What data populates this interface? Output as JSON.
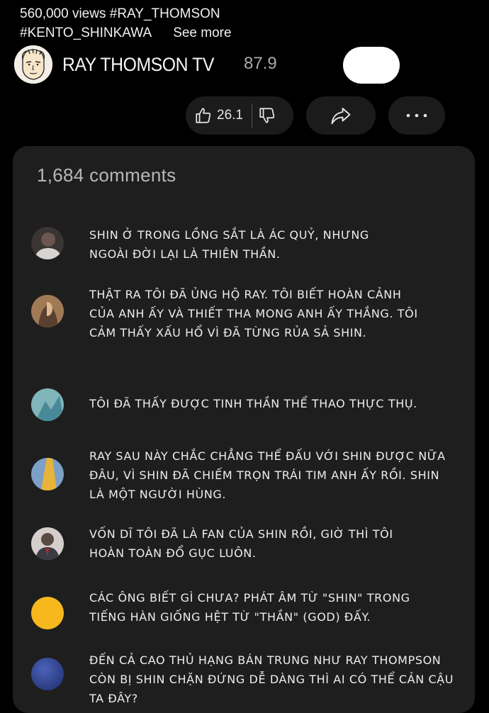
{
  "video": {
    "views_tags": "560,000 views #RAY_THOMSON",
    "tag2": "#KENTO_SHINKAWA",
    "see_more": "See more"
  },
  "channel": {
    "name": "RAY THOMSON TV",
    "subscribers": "87.9"
  },
  "actions": {
    "likes": "26.1"
  },
  "comments": {
    "count_label": "1,684 comments",
    "items": [
      {
        "text": "SHIN Ở TRONG LỒNG SẮT LÀ ÁC QUỶ, NHƯNG\nNGOÀI ĐỜI LẠI LÀ THIÊN THẦN.",
        "avatar_color": "#5a4a48"
      },
      {
        "text": "THẬT RA TÔI ĐÃ ỦNG HỘ RAY. TÔI BIẾT HOÀN CẢNH\nCỦA ANH ẤY VÀ THIẾT THA MONG ANH ẤY THẮNG. TÔI\nCẢM THẤY XẤU HỔ VÌ ĐÃ TỪNG RỦA SẢ SHIN.",
        "avatar_color": "#8a6a4e"
      },
      {
        "text": "TÔI ĐÃ THẤY ĐƯỢC TINH THẦN THỂ THAO THỰC THỤ.",
        "avatar_color": "#6aa3a8"
      },
      {
        "text": "RAY SAU NÀY CHẮC CHẲNG THỂ ĐẤU VỚI SHIN ĐƯỢC NỮA\nĐÂU, VÌ SHIN ĐÃ CHIẾM TRỌN TRÁI TIM ANH ẤY RỒI. SHIN\nLÀ MỘT NGƯỜI HÙNG.",
        "avatar_color": "#6f8fb0"
      },
      {
        "text": "VỐN DĨ TÔI ĐÃ LÀ FAN CỦA SHIN RỒI, GIỜ THÌ TÔI\nHOÀN TOÀN ĐỔ GỤC LUÔN.",
        "avatar_color": "#c9c3bd"
      },
      {
        "text": "CÁC ÔNG BIẾT GÌ CHƯA? PHÁT ÂM TỪ \"SHIN\" TRONG\nTIẾNG HÀN GIỐNG HỆT TỪ \"THẦN\" (GOD) ĐẤY.",
        "avatar_color": "#f6b81d"
      },
      {
        "text": "ĐẾN CẢ CAO THỦ HẠNG BÁN TRUNG NHƯ RAY THOMPSON\nCÒN BỊ SHIN CHẶN ĐỨNG DỄ DÀNG THÌ AI CÓ THỂ CẢN CẬU\nTA ĐÂY?",
        "avatar_color": "#2c3f8c"
      }
    ]
  }
}
